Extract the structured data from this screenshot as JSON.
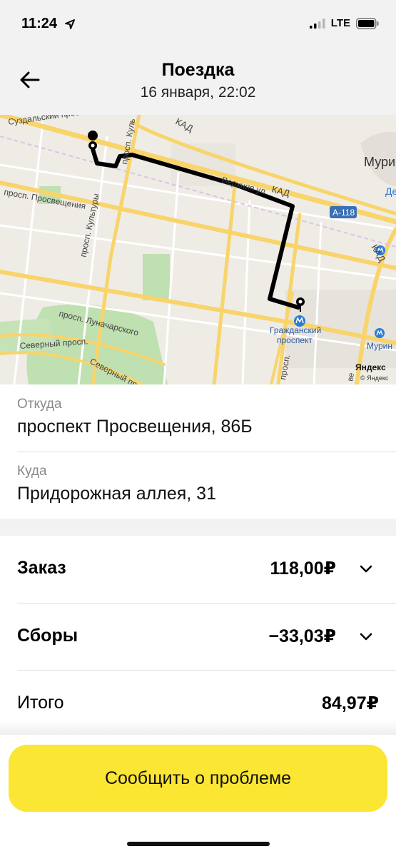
{
  "status_bar": {
    "time": "11:24",
    "network": "LTE"
  },
  "header": {
    "title": "Поездка",
    "subtitle": "16 января, 22:02"
  },
  "map": {
    "labels": {
      "suzdalsky": "Суздальский просп.",
      "kult": "просп. Куль",
      "kad_top": "КАД",
      "kad_mid": "КАД",
      "kad_right": "КАД",
      "murino": "Мури",
      "de": "Де",
      "a118": "А-118",
      "verkhnyaya": "Верхняя ул.",
      "prosvescheniya": "просп. Просвещения",
      "kultury": "просп. Культуры",
      "lunacharskogo": "просп. Луначарского",
      "severny1": "Северный просп.",
      "severny2": "Северный пр",
      "grazhdansky_1": "Гражданский",
      "grazhdansky_2": "проспект",
      "grazhdansky_road": "просп.",
      "murino_station": "Мурин",
      "yandex_logo": "Яндекс",
      "yandex_copy": "© Яндекс",
      "ve": "ве"
    },
    "colors": {
      "road": "#f8d46a",
      "park": "#bfe0b0",
      "route": "#000000"
    }
  },
  "trip": {
    "from_label": "Откуда",
    "from_value": "проспект Просвещения, 86Б",
    "to_label": "Куда",
    "to_value": "Придорожная аллея, 31"
  },
  "costs": {
    "order_label": "Заказ",
    "order_value": "118,00₽",
    "fees_label": "Сборы",
    "fees_value": "−33,03₽",
    "total_label": "Итого",
    "total_value": "84,97₽"
  },
  "actions": {
    "report_label": "Сообщить о проблеме"
  },
  "colors": {
    "accent": "#fae633"
  }
}
